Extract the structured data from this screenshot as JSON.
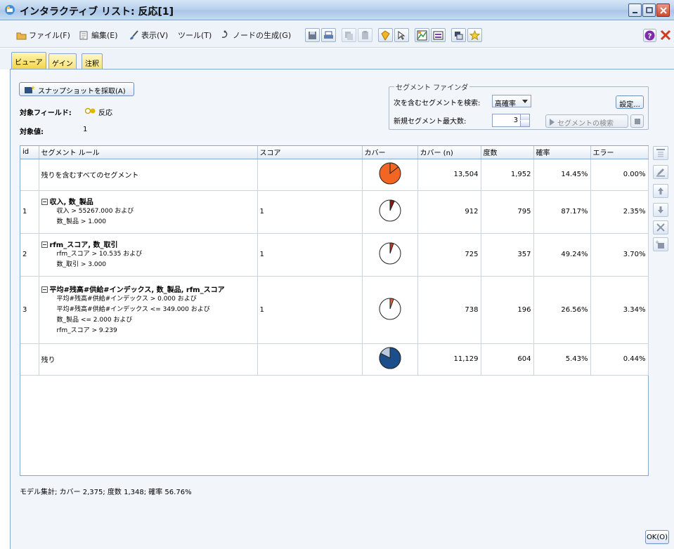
{
  "window": {
    "title": "インタラクティブ リスト: 反応[1]"
  },
  "menu": {
    "file": "ファイル(F)",
    "edit": "編集(E)",
    "view": "表示(V)",
    "tools": "ツール(T)",
    "generate": "ノードの生成(G)"
  },
  "tabs": [
    "ビューア",
    "ゲイン",
    "注釈"
  ],
  "snapshot": {
    "label": "スナップショットを採取(A)"
  },
  "target": {
    "field_label": "対象フィールド:",
    "field_value": "反応",
    "value_label": "対象値:",
    "value": "1"
  },
  "finder": {
    "legend": "セグメント ファインダ",
    "search_label": "次を含むセグメントを検索:",
    "search_value": "高確率",
    "max_label": "新規セグメント最大数:",
    "max_value": "3",
    "settings": "設定...",
    "find": "セグメントの検索"
  },
  "table": {
    "headers": [
      "id",
      "セグメント ルール",
      "スコア",
      "カバー",
      "カバー (n)",
      "度数",
      "確率",
      "エラー"
    ],
    "rows": [
      {
        "id": "",
        "head": "残りを含むすべてのセグメント",
        "lines": [],
        "score": "",
        "pie_fraction": 0.1445,
        "pie_color": "#f26522",
        "pie_slice": "#f26522",
        "cover_n": "13,504",
        "freq": "1,952",
        "prob": "14.45%",
        "error": "0.00%"
      },
      {
        "id": "1",
        "head": "収入, 数_製品",
        "lines": [
          "収入 > 55267.000 および",
          "数_製品 > 1.000"
        ],
        "score": "1",
        "pie_fraction": 0.0675,
        "pie_color": "#ffffff",
        "pie_slice": "#8b1a10",
        "cover_n": "912",
        "freq": "795",
        "prob": "87.17%",
        "error": "2.35%"
      },
      {
        "id": "2",
        "head": "rfm_スコア, 数_取引",
        "lines": [
          "rfm_スコア > 10.535 および",
          "数_取引 > 3.000"
        ],
        "score": "1",
        "pie_fraction": 0.0537,
        "pie_color": "#ffffff",
        "pie_slice": "#c0391b",
        "cover_n": "725",
        "freq": "357",
        "prob": "49.24%",
        "error": "3.70%"
      },
      {
        "id": "3",
        "head": "平均#残高#供給#インデックス, 数_製品, rfm_スコア",
        "lines": [
          "平均#残高#供給#インデックス > 0.000 および",
          "平均#残高#供給#インデックス <= 349.000 および",
          "数_製品 <= 2.000 および",
          "rfm_スコア > 9.239"
        ],
        "score": "1",
        "pie_fraction": 0.0547,
        "pie_color": "#ffffff",
        "pie_slice": "#e0603a",
        "cover_n": "738",
        "freq": "196",
        "prob": "26.56%",
        "error": "3.34%"
      },
      {
        "id": "",
        "head": "残り",
        "lines": [],
        "score": "",
        "pie_fraction": 0.8241,
        "pie_color": "#b8c8e0",
        "pie_slice": "#1d4e8c",
        "cover_n": "11,129",
        "freq": "604",
        "prob": "5.43%",
        "error": "0.44%"
      }
    ]
  },
  "footer": {
    "summary": "モデル集計; カバー 2,375; 度数 1,348; 確率 56.76%"
  },
  "ok": "OK(O)"
}
